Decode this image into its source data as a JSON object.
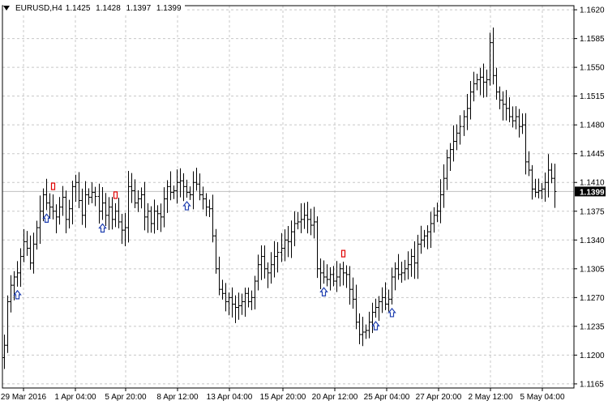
{
  "header": {
    "symbol": "EURUSD,H4",
    "open": "1.1425",
    "high": "1.1428",
    "low": "1.1397",
    "close": "1.1399"
  },
  "colors": {
    "background": "#ffffff",
    "bars": "#000000",
    "grid": "#c8c8c8",
    "price_line": "#c0c0c0",
    "price_tag_bg": "#000000",
    "price_tag_text": "#ffffff",
    "buy_arrow": "#1f3fb0",
    "sell_arrow": "#e00000"
  },
  "chart_data": {
    "type": "ohlc",
    "symbol": "EURUSD",
    "timeframe": "H4",
    "grid": true,
    "ylim": [
      1.116,
      1.1625
    ],
    "y_ticks": [
      "1.1620",
      "1.1585",
      "1.1550",
      "1.1515",
      "1.1480",
      "1.1445",
      "1.1410",
      "1.1375",
      "1.1340",
      "1.1305",
      "1.1270",
      "1.1235",
      "1.1200",
      "1.1165"
    ],
    "x_labels": [
      "29 Mar 2016",
      "1 Apr 04:00",
      "5 Apr 20:00",
      "8 Apr 12:00",
      "13 Apr 04:00",
      "15 Apr 20:00",
      "20 Apr 12:00",
      "25 Apr 04:00",
      "27 Apr 20:00",
      "2 May 12:00",
      "5 May 04:00"
    ],
    "current_price": "1.1399",
    "current_price_value": 1.1399,
    "closes": [
      1.1212,
      1.1265,
      1.1285,
      1.1295,
      1.13,
      1.132,
      1.1338,
      1.133,
      1.1312,
      1.1335,
      1.1355,
      1.1375,
      1.1395,
      1.1385,
      1.138,
      1.1375,
      1.1368,
      1.138,
      1.1392,
      1.1365,
      1.1378,
      1.1405,
      1.141,
      1.1388,
      1.137,
      1.1395,
      1.1392,
      1.1398,
      1.1393,
      1.1375,
      1.1385,
      1.137,
      1.138,
      1.1365,
      1.1375,
      1.1362,
      1.1352,
      1.1355,
      1.1405,
      1.14,
      1.1385,
      1.139,
      1.1395,
      1.1368,
      1.1375,
      1.136,
      1.1375,
      1.1372,
      1.1368,
      1.139,
      1.1405,
      1.1398,
      1.14,
      1.141,
      1.1412,
      1.1405,
      1.1398,
      1.1395,
      1.141,
      1.1408,
      1.1395,
      1.139,
      1.138,
      1.1378,
      1.1345,
      1.1305,
      1.128,
      1.1275,
      1.1265,
      1.127,
      1.1262,
      1.1258,
      1.126,
      1.1265,
      1.1275,
      1.1265,
      1.127,
      1.129,
      1.131,
      1.132,
      1.1305,
      1.13,
      1.131,
      1.132,
      1.1325,
      1.133,
      1.134,
      1.1338,
      1.135,
      1.136,
      1.1362,
      1.1365,
      1.137,
      1.1365,
      1.1358,
      1.1362,
      1.1305,
      1.13,
      1.1295,
      1.1292,
      1.1298,
      1.129,
      1.1295,
      1.1305,
      1.13,
      1.1298,
      1.128,
      1.1268,
      1.124,
      1.1225,
      1.1228,
      1.123,
      1.124,
      1.1252,
      1.1258,
      1.1265,
      1.127,
      1.1262,
      1.1268,
      1.1295,
      1.1305,
      1.1298,
      1.13,
      1.1305,
      1.131,
      1.132,
      1.1312,
      1.1335,
      1.134,
      1.1345,
      1.135,
      1.136,
      1.137,
      1.1375,
      1.1395,
      1.1415,
      1.144,
      1.145,
      1.146,
      1.147,
      1.1478,
      1.149,
      1.15,
      1.152,
      1.153,
      1.1535,
      1.1538,
      1.1532,
      1.1535,
      1.158,
      1.154,
      1.152,
      1.151,
      1.1505,
      1.15,
      1.149,
      1.1485,
      1.149,
      1.1478,
      1.148,
      1.1435,
      1.1425,
      1.1402,
      1.1398,
      1.14,
      1.1402,
      1.141,
      1.1425,
      1.1415,
      1.1399
    ],
    "buy_signals": [
      4,
      13,
      30,
      56,
      98,
      114,
      119
    ],
    "sell_signals": [
      15,
      34,
      104
    ]
  }
}
